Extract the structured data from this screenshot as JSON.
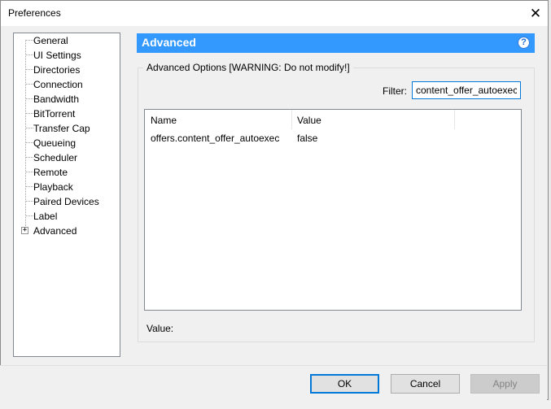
{
  "window": {
    "title": "Preferences"
  },
  "tree": {
    "items": [
      {
        "label": "General"
      },
      {
        "label": "UI Settings"
      },
      {
        "label": "Directories"
      },
      {
        "label": "Connection"
      },
      {
        "label": "Bandwidth"
      },
      {
        "label": "BitTorrent"
      },
      {
        "label": "Transfer Cap"
      },
      {
        "label": "Queueing"
      },
      {
        "label": "Scheduler"
      },
      {
        "label": "Remote"
      },
      {
        "label": "Playback"
      },
      {
        "label": "Paired Devices"
      },
      {
        "label": "Label"
      },
      {
        "label": "Advanced",
        "selected": true,
        "expandable": true
      }
    ]
  },
  "panel": {
    "title": "Advanced",
    "help_glyph": "?",
    "group_label": "Advanced Options [WARNING: Do not modify!]",
    "filter_label": "Filter:",
    "filter_value": "content_offer_autoexec",
    "columns": [
      "Name",
      "Value"
    ],
    "rows": [
      {
        "name": "offers.content_offer_autoexec",
        "value": "false"
      }
    ],
    "value_label": "Value:"
  },
  "buttons": {
    "ok": "OK",
    "cancel": "Cancel",
    "apply": "Apply"
  },
  "icons": {
    "close": "close-icon",
    "help": "help-icon",
    "expander": "plus-expander-icon"
  },
  "colors": {
    "header_bg": "#3399ff",
    "focus_border": "#0078d7"
  }
}
